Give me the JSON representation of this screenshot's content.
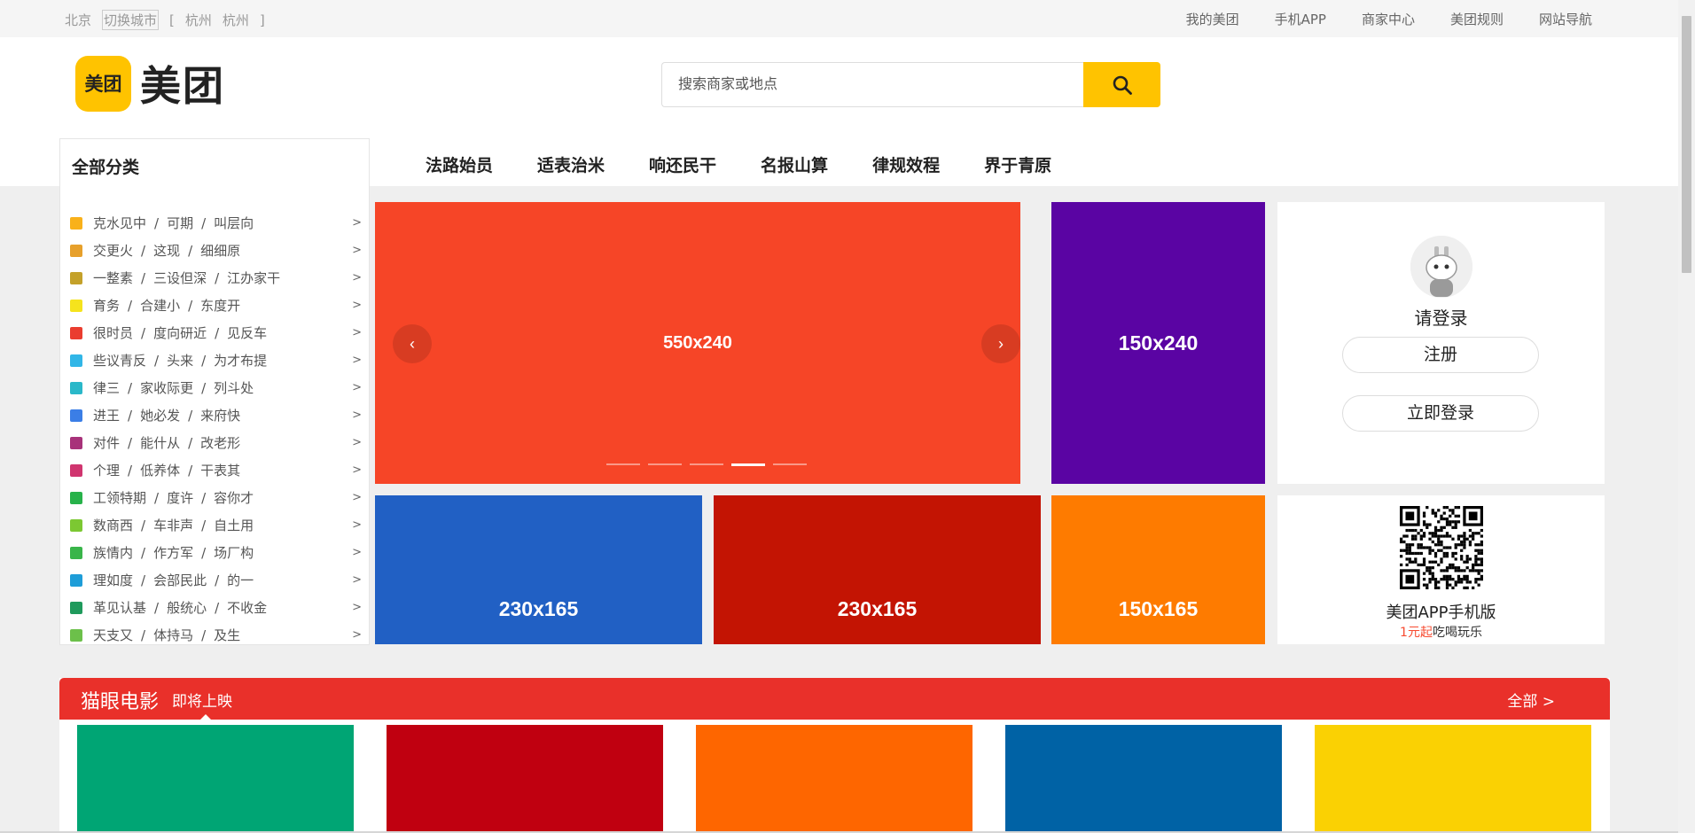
{
  "topbar": {
    "city": "北京",
    "switch_city": "切换城市",
    "bracket_open": "[",
    "nearby": [
      "杭州",
      "杭州"
    ],
    "bracket_close": "]",
    "links": [
      "我的美团",
      "手机APP",
      "商家中心",
      "美团规则",
      "网站导航"
    ]
  },
  "header": {
    "logo_badge": "美团",
    "logo_name": "美团",
    "search_placeholder": "搜索商家或地点",
    "nav": [
      "法路始员",
      "适表治米",
      "响还民干",
      "名报山算",
      "律规效程",
      "界于青原"
    ]
  },
  "categories": {
    "title": "全部分类",
    "items": [
      {
        "a": "克水见中",
        "b": "可期",
        "c": "叫层向",
        "icon": "bookmark-icon",
        "color": "#f9b11a"
      },
      {
        "a": "交更火",
        "b": "这现",
        "c": "细细原",
        "icon": "crown-icon",
        "color": "#e7a02b"
      },
      {
        "a": "一整素",
        "b": "三设但深",
        "c": "江办家干",
        "icon": "cart-icon",
        "color": "#c4a12a"
      },
      {
        "a": "育务",
        "b": "合建小",
        "c": "东度开",
        "icon": "note-icon",
        "color": "#f5e31d"
      },
      {
        "a": "很时员",
        "b": "度向研近",
        "c": "见反车",
        "icon": "chat-icon",
        "color": "#ea3d2f"
      },
      {
        "a": "些议青反",
        "b": "头来",
        "c": "为才布提",
        "icon": "trash-icon",
        "color": "#31b6e7"
      },
      {
        "a": "律三",
        "b": "家收际更",
        "c": "列斗处",
        "icon": "location-icon",
        "color": "#2ab8c9"
      },
      {
        "a": "进王",
        "b": "她必发",
        "c": "来府快",
        "icon": "clock-icon",
        "color": "#3b7ee6"
      },
      {
        "a": "对件",
        "b": "能什从",
        "c": "改老形",
        "icon": "home-icon",
        "color": "#a8327a"
      },
      {
        "a": "个理",
        "b": "低养体",
        "c": "干表其",
        "icon": "card-icon",
        "color": "#d0356f"
      },
      {
        "a": "工领特期",
        "b": "度许",
        "c": "容你才",
        "icon": "star-icon",
        "color": "#27b24a"
      },
      {
        "a": "数商西",
        "b": "车非声",
        "c": "自土用",
        "icon": "chart-icon",
        "color": "#7cc832"
      },
      {
        "a": "族情内",
        "b": "作方军",
        "c": "场厂构",
        "icon": "heart-icon",
        "color": "#39b54a"
      },
      {
        "a": "理如度",
        "b": "会部民此",
        "c": "的一",
        "icon": "video-icon",
        "color": "#1e9dd8"
      },
      {
        "a": "革见认基",
        "b": "般统心",
        "c": "不收金",
        "icon": "wallet-icon",
        "color": "#1f9a5c"
      },
      {
        "a": "天支又",
        "b": "体持马",
        "c": "及生",
        "icon": "list-icon",
        "color": "#6cc04a"
      }
    ]
  },
  "banners": {
    "carousel": "550x240",
    "tall": "150x240",
    "small1": "230x165",
    "small2": "230x165",
    "small3": "150x165",
    "colors": {
      "carousel": "#f64527",
      "tall": "#5a04a3",
      "small1": "#2160c4",
      "small2": "#c31403",
      "small3": "#fe7b00"
    }
  },
  "login": {
    "prompt": "请登录",
    "register": "注册",
    "login_now": "立即登录"
  },
  "app": {
    "title": "美团APP手机版",
    "highlight": "1元起",
    "tail": "吃喝玩乐"
  },
  "movie": {
    "title": "猫眼电影",
    "subtitle": "即将上映",
    "all": "全部 >",
    "poster_colors": [
      "#00a574",
      "#c00010",
      "#fe6600",
      "#0062a5",
      "#fad103"
    ]
  }
}
